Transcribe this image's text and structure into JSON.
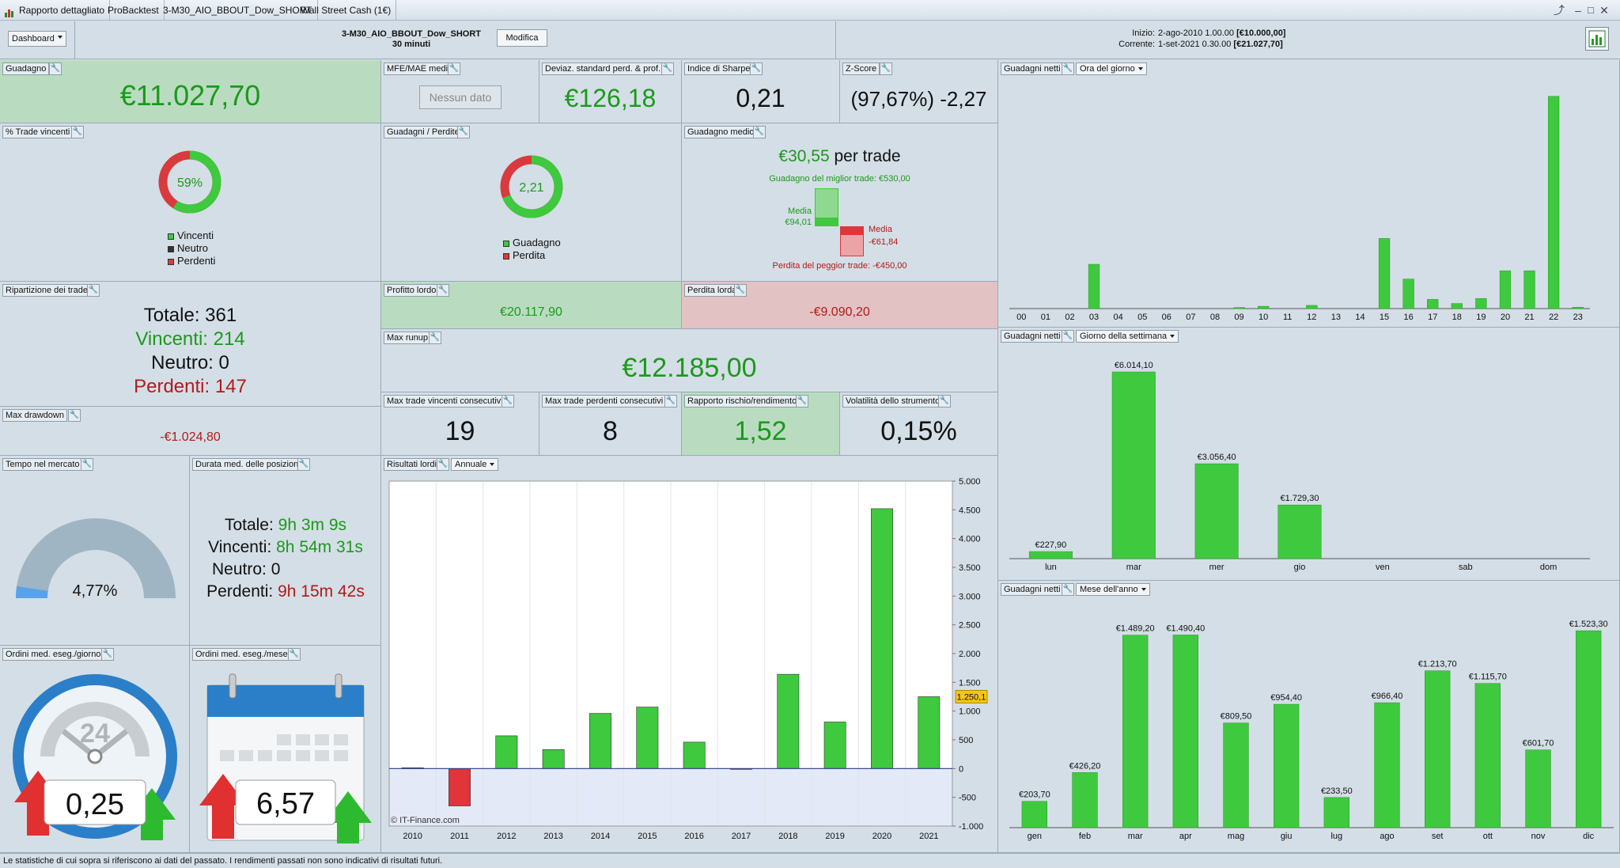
{
  "titlebar": {
    "tabs": [
      "Rapporto dettagliato",
      "ProBacktest",
      "3-M30_AIO_BBOUT_Dow_SHORT",
      "Wall Street Cash (1€)"
    ]
  },
  "toolbar": {
    "dashboard_label": "Dashboard",
    "strategy_name": "3-M30_AIO_BBOUT_Dow_SHORT",
    "timeframe": "30 minuti",
    "edit_label": "Modifica",
    "start_label": "Inizio:",
    "start_value": "2-ago-2010 1.00.00",
    "start_capital": "[€10.000,00]",
    "current_label": "Corrente:",
    "current_value": "1-set-2021 0.30.00",
    "current_capital": "[€21.027,70]"
  },
  "kpi": {
    "gain": {
      "title": "Guadagno",
      "value": "€11.027,70"
    },
    "mfe": {
      "title": "MFE/MAE medio",
      "value": "Nessun dato"
    },
    "stddev": {
      "title": "Deviaz. standard perd. & prof.",
      "value": "€126,18"
    },
    "sharpe": {
      "title": "Indice di Sharpe",
      "value": "0,21"
    },
    "zscore": {
      "title": "Z-Score",
      "value": "(97,67%) -2,27"
    }
  },
  "winpct": {
    "title": "% Trade vincenti",
    "value": "59%",
    "fraction": 0.59,
    "legend": [
      "Vincenti",
      "Neutro",
      "Perdenti"
    ]
  },
  "gainloss": {
    "title": "Guadagni / Perdite",
    "value": "2,21",
    "fraction": 0.69,
    "legend": [
      "Guadagno",
      "Perdita"
    ]
  },
  "avg": {
    "title": "Guadagno medio",
    "value": "€30,55",
    "suffix": "per trade",
    "best": "Guadagno del miglior trade: €530,00",
    "media_label": "Media",
    "media_win": "€94,01",
    "media_loss": "-€61,84",
    "worst": "Perdita del peggior trade: -€450,00"
  },
  "breakdown": {
    "title": "Ripartizione dei trade",
    "total": "Totale: 361",
    "win": "Vincenti: 214",
    "neutral": "Neutro: 0",
    "lose": "Perdenti: 147"
  },
  "gross_profit": {
    "title": "Profitto lordo",
    "value": "€20.117,90"
  },
  "gross_loss": {
    "title": "Perdita lorda",
    "value": "-€9.090,20"
  },
  "runup": {
    "title": "Max runup",
    "value": "€12.185,00"
  },
  "drawdown": {
    "title": "Max drawdown",
    "value": "-€1.024,80"
  },
  "consec_win": {
    "title": "Max trade vincenti consecutivi",
    "value": "19"
  },
  "consec_loss": {
    "title": "Max trade perdenti consecutivi",
    "value": "8"
  },
  "rr": {
    "title": "Rapporto rischio/rendimento",
    "value": "1,52"
  },
  "volatility": {
    "title": "Volatilità dello strumento",
    "value": "0,15%"
  },
  "time_market": {
    "title": "Tempo nel mercato",
    "value": "4,77%",
    "fraction": 0.0477
  },
  "duration": {
    "title": "Durata med. delle posizioni",
    "total_label": "Totale:",
    "total": "9h 3m 9s",
    "win_label": "Vincenti:",
    "win": "8h 54m 31s",
    "neutral_label": "Neutro:",
    "neutral": "0",
    "lose_label": "Perdenti:",
    "lose": "9h 15m 42s"
  },
  "orders_day": {
    "title": "Ordini med. eseg./giorno",
    "value": "0,25",
    "clock_label": "24"
  },
  "orders_month": {
    "title": "Ordini med. eseg./mese",
    "value": "6,57"
  },
  "chart_data": [
    {
      "id": "hourly",
      "type": "bar",
      "title": "Guadagni netti",
      "selector": "Ora del giorno",
      "categories": [
        "00",
        "01",
        "02",
        "03",
        "04",
        "05",
        "06",
        "07",
        "08",
        "09",
        "10",
        "11",
        "12",
        "13",
        "14",
        "15",
        "16",
        "17",
        "18",
        "19",
        "20",
        "21",
        "22",
        "23"
      ],
      "values": [
        0,
        0,
        0,
        480,
        0,
        0,
        0,
        0,
        0,
        12,
        25,
        0,
        35,
        0,
        0,
        760,
        320,
        100,
        55,
        110,
        410,
        410,
        2300,
        15
      ],
      "ylim": [
        0,
        2400
      ]
    },
    {
      "id": "weekday",
      "type": "bar",
      "title": "Guadagni netti",
      "selector": "Giorno della settimana",
      "categories": [
        "lun",
        "mar",
        "mer",
        "gio",
        "ven",
        "sab",
        "dom"
      ],
      "values": [
        227.9,
        6014.1,
        3056.4,
        1729.3,
        0,
        0,
        0
      ],
      "labels": [
        "€227,90",
        "€6.014,10",
        "€3.056,40",
        "€1.729,30",
        "",
        "",
        ""
      ],
      "ylim": [
        0,
        6014.1
      ]
    },
    {
      "id": "monthly",
      "type": "bar",
      "title": "Guadagni netti",
      "selector": "Mese dell'anno",
      "categories": [
        "gen",
        "feb",
        "mar",
        "apr",
        "mag",
        "giu",
        "lug",
        "ago",
        "set",
        "ott",
        "nov",
        "dic"
      ],
      "values": [
        203.7,
        426.2,
        1489.2,
        1490.4,
        809.5,
        954.4,
        233.5,
        966.4,
        1213.7,
        1115.7,
        601.7,
        1523.3
      ],
      "labels": [
        "€203,70",
        "€426,20",
        "€1.489,20",
        "€1.490,40",
        "€809,50",
        "€954,40",
        "€233,50",
        "€966,40",
        "€1.213,70",
        "€1.115,70",
        "€601,70",
        "€1.523,30"
      ],
      "ylim": [
        0,
        1530
      ]
    },
    {
      "id": "yearly",
      "type": "bar",
      "title": "Risultati lordi",
      "selector": "Annuale",
      "categories": [
        "2010",
        "2011",
        "2012",
        "2013",
        "2014",
        "2015",
        "2016",
        "2017",
        "2018",
        "2019",
        "2020",
        "2021"
      ],
      "values": [
        15,
        -650,
        570,
        330,
        960,
        1070,
        460,
        -10,
        1640,
        810,
        4520,
        1250.1
      ],
      "yticks": [
        "5.000",
        "4.500",
        "4.000",
        "3.500",
        "3.000",
        "2.500",
        "2.000",
        "1.500",
        "1.000",
        "500",
        "0",
        "-500",
        "-1.000"
      ],
      "ylim": [
        -1000,
        5000
      ],
      "last_marker": "1.250,1",
      "watermark": "© IT-Finance.com"
    }
  ],
  "status": "Le statistiche di cui sopra si riferiscono ai dati del passato. I rendimenti passati non sono indicativi di risultati futuri.",
  "colors": {
    "bar": "#3ec93e",
    "loss": "#e0353a",
    "panel": "#d4dee6",
    "green_panel": "#b9dcc0",
    "red_panel": "#e3c2c4",
    "text_green": "#1a9a1a",
    "text_red": "#b21a1a"
  }
}
